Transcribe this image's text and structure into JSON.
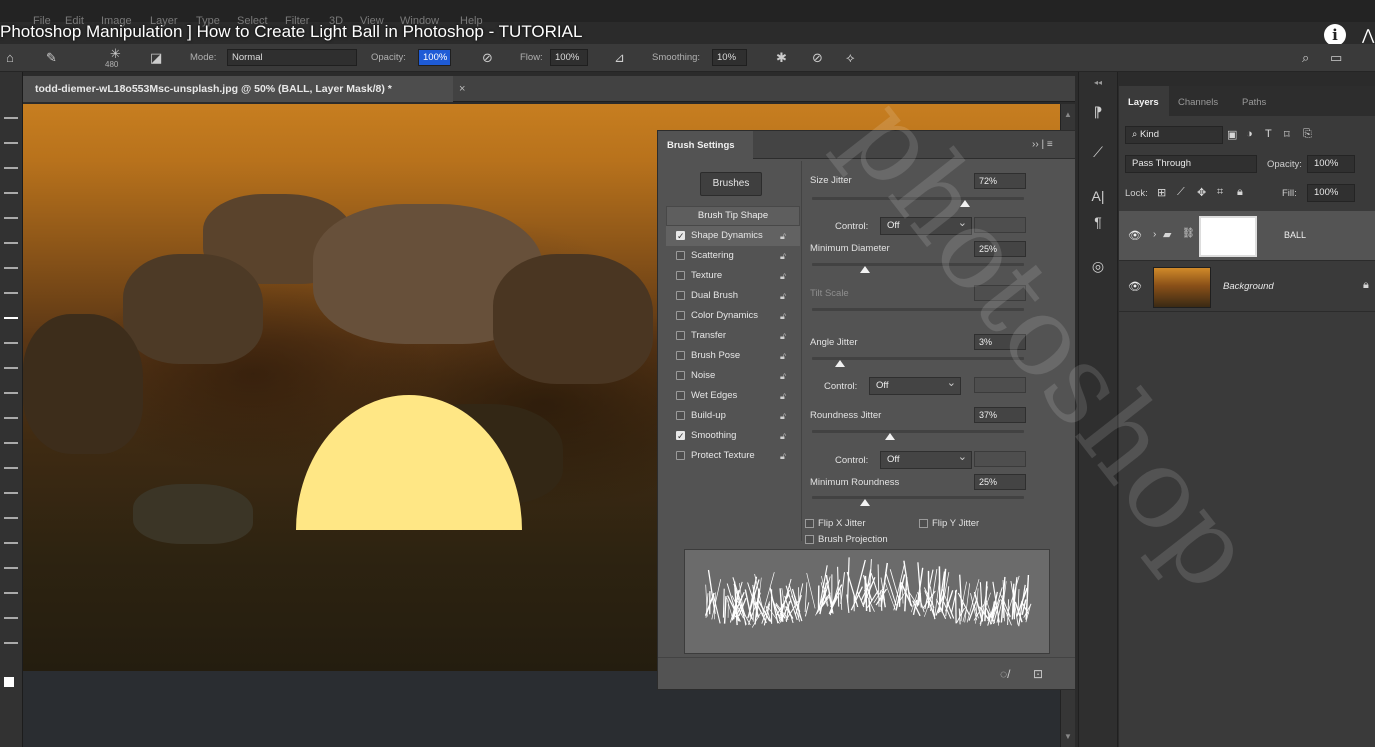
{
  "menu": [
    "File",
    "Edit",
    "Image",
    "Layer",
    "Type",
    "Select",
    "Filter",
    "3D",
    "View",
    "Window",
    "Help"
  ],
  "video_title": "Photoshop Manipulation ] How to Create Light Ball in Photoshop - TUTORIAL",
  "options": {
    "brush_size": "480",
    "mode_label": "Mode:",
    "mode_value": "Normal",
    "opacity_label": "Opacity:",
    "opacity_value": "100%",
    "flow_label": "Flow:",
    "flow_value": "100%",
    "smoothing_label": "Smoothing:",
    "smoothing_value": "10%"
  },
  "document": {
    "tab_title": "todd-diemer-wL18o553Msc-unsplash.jpg @ 50% (BALL, Layer Mask/8) *",
    "close": "×"
  },
  "brush_settings": {
    "title": "Brush Settings",
    "brushes_button": "Brushes",
    "tip_shape": "Brush Tip Shape",
    "items": [
      {
        "label": "Shape Dynamics",
        "checked": true,
        "active": true
      },
      {
        "label": "Scattering",
        "checked": false
      },
      {
        "label": "Texture",
        "checked": false
      },
      {
        "label": "Dual Brush",
        "checked": false
      },
      {
        "label": "Color Dynamics",
        "checked": false
      },
      {
        "label": "Transfer",
        "checked": false
      },
      {
        "label": "Brush Pose",
        "checked": false
      },
      {
        "label": "Noise",
        "checked": false
      },
      {
        "label": "Wet Edges",
        "checked": false
      },
      {
        "label": "Build-up",
        "checked": false
      },
      {
        "label": "Smoothing",
        "checked": true
      },
      {
        "label": "Protect Texture",
        "checked": false
      }
    ],
    "size_jitter": {
      "label": "Size Jitter",
      "value": "72%",
      "level": 0.72
    },
    "control_label": "Control:",
    "control_1": "Off",
    "min_diameter": {
      "label": "Minimum Diameter",
      "value": "25%",
      "level": 0.25
    },
    "tilt_scale": "Tilt Scale",
    "angle_jitter": {
      "label": "Angle Jitter",
      "value": "3%",
      "level": 0.13
    },
    "control_2": "Off",
    "roundness_jitter": {
      "label": "Roundness Jitter",
      "value": "37%",
      "level": 0.37
    },
    "control_3": "Off",
    "min_roundness": {
      "label": "Minimum Roundness",
      "value": "25%",
      "level": 0.25
    },
    "flip_x": "Flip X Jitter",
    "flip_y": "Flip Y Jitter",
    "brush_projection": "Brush Projection"
  },
  "layers_panel": {
    "tabs": [
      "Layers",
      "Channels",
      "Paths"
    ],
    "kind": "Kind",
    "blend_mode": "Pass Through",
    "opacity_label": "Opacity:",
    "opacity_value": "100%",
    "lock_label": "Lock:",
    "fill_label": "Fill:",
    "fill_value": "100%",
    "layers": [
      {
        "name": "BALL",
        "selected": true
      },
      {
        "name": "Background",
        "selected": false
      }
    ]
  },
  "colors": {
    "ball": "#ffe785",
    "accent": "#1e5bd6"
  },
  "watermark": "photoshop"
}
